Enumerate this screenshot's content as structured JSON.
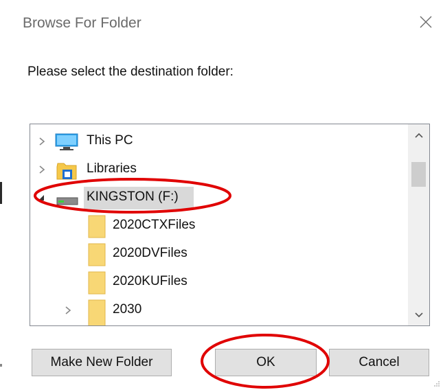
{
  "dialog": {
    "title": "Browse For Folder",
    "prompt": "Please select the destination folder:",
    "close_icon": "close-icon"
  },
  "tree": {
    "items": [
      {
        "label": "This PC",
        "icon": "this-pc-icon",
        "expander": "collapsed"
      },
      {
        "label": "Libraries",
        "icon": "libraries-icon",
        "expander": "collapsed"
      },
      {
        "label": "KINGSTON (F:)",
        "icon": "drive-icon",
        "expander": "expanded",
        "selected": true
      },
      {
        "label": "2020CTXFiles",
        "icon": "folder-icon",
        "expander": "none"
      },
      {
        "label": "2020DVFiles",
        "icon": "folder-icon",
        "expander": "none"
      },
      {
        "label": "2020KUFiles",
        "icon": "folder-icon",
        "expander": "none"
      },
      {
        "label": "2030",
        "icon": "folder-icon",
        "expander": "collapsed"
      }
    ]
  },
  "buttons": {
    "make_new_folder": "Make New Folder",
    "ok": "OK",
    "cancel": "Cancel"
  },
  "colors": {
    "selected_row": "#d9d9d9",
    "annotation_red": "#e00000",
    "folder_yellow": "#f8d775",
    "button_face": "#e1e1e1"
  }
}
